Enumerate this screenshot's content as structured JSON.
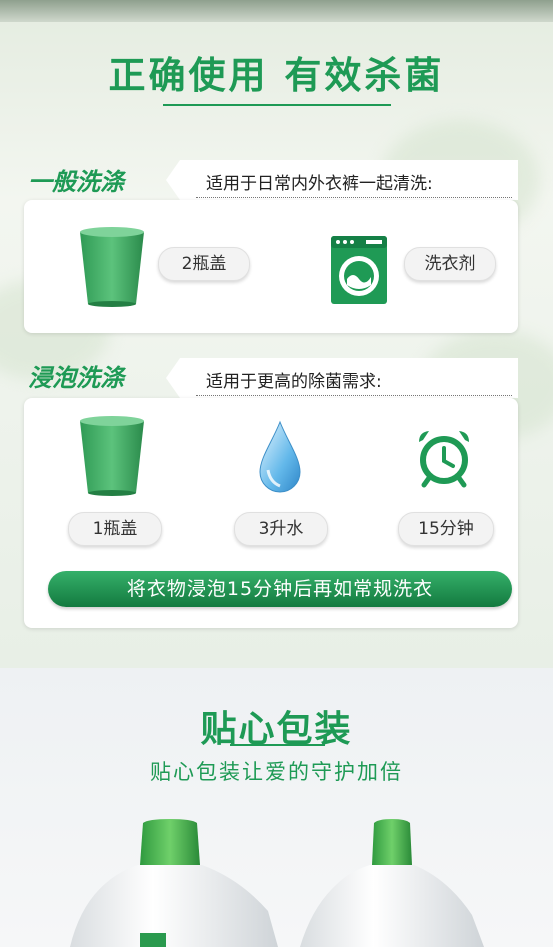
{
  "section_usage": {
    "title": "正确使用 有效杀菌",
    "general": {
      "label": "一般洗涤",
      "description": "适用于日常内外衣裤一起清洗:",
      "items": [
        {
          "icon": "measuring-cup-icon",
          "text": "2瓶盖"
        },
        {
          "icon": "washing-machine-icon",
          "text": "洗衣剂"
        }
      ]
    },
    "soak": {
      "label": "浸泡洗涤",
      "description": "适用于更高的除菌需求:",
      "items": [
        {
          "icon": "measuring-cup-icon",
          "text": "1瓶盖"
        },
        {
          "icon": "water-drop-icon",
          "text": "3升水"
        },
        {
          "icon": "alarm-clock-icon",
          "text": "15分钟"
        }
      ],
      "banner": "将衣物浸泡15分钟后再如常规洗衣"
    }
  },
  "section_packaging": {
    "title": "贴心包装",
    "subtitle": "贴心包装让爱的守护加倍"
  },
  "colors": {
    "brand_green": "#1e9a55",
    "dark_green": "#137a3f"
  }
}
